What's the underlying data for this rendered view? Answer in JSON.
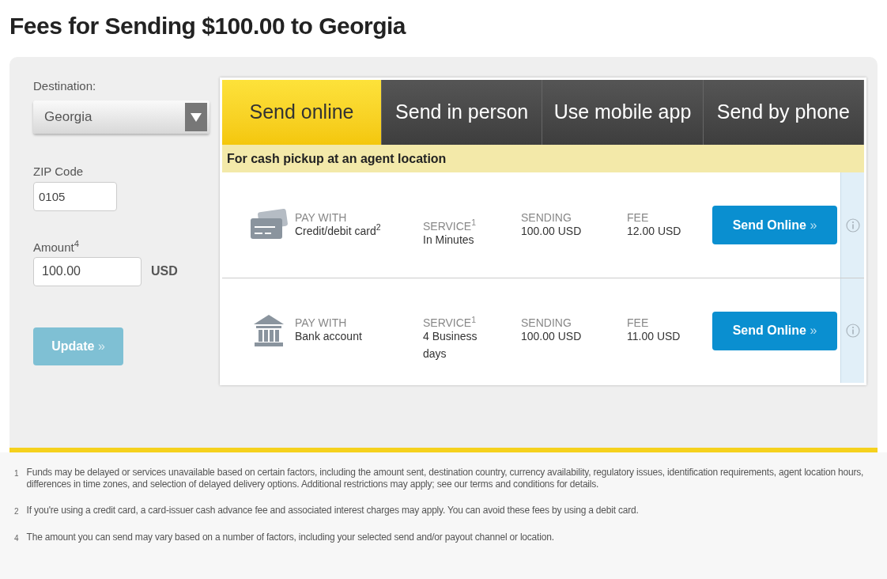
{
  "title": "Fees for Sending $100.00 to Georgia",
  "form": {
    "destination": {
      "label": "Destination:",
      "value": "Georgia"
    },
    "zip": {
      "label": "ZIP Code",
      "value": "0105"
    },
    "amount": {
      "label": "Amount$^{4}$",
      "value": "100.00",
      "currency": "USD"
    },
    "update": {
      "label": "Update",
      "chevron": "»",
      "disabled": true
    }
  },
  "tabs": [
    {
      "label": "Send online",
      "selected": true
    },
    {
      "label": "Send in person",
      "selected": false
    },
    {
      "label": "Use mobile app",
      "selected": false
    },
    {
      "label": "Send by phone",
      "selected": false
    }
  ],
  "banner": "For cash pickup at an agent location",
  "options": [
    {
      "kind": "card",
      "pay_label": "PAY WITH",
      "pay_value": "Credit/debit card$^{2}$",
      "service_label": "SERVICE$^{1}$",
      "service_value": "In Minutes",
      "sending_label": "SENDING",
      "sending_value": "100.00 USD",
      "fee_label": "FEE",
      "fee_value": "12.00 USD",
      "button": "Send Online",
      "chevron": "»"
    },
    {
      "kind": "bank",
      "pay_label": "PAY WITH",
      "pay_value": "Bank account",
      "service_label": "SERVICE$^{1}$",
      "service_value": "4 Business days",
      "sending_label": "SENDING",
      "sending_value": "100.00 USD",
      "fee_label": "FEE",
      "fee_value": "11.00 USD",
      "button": "Send Online",
      "chevron": "»"
    }
  ],
  "footnotes": [
    {
      "mark": "1",
      "text": "Funds may be delayed or services unavailable based on certain factors, including the amount sent, destination country, currency availability, regulatory issues, identification requirements, agent location hours, differences in time zones, and selection of delayed delivery options. Additional restrictions may apply; see our terms and conditions for details."
    },
    {
      "mark": "2",
      "text": "If you're using a credit card, a card-issuer cash advance fee and associated interest charges may apply. You can avoid these fees by using a debit card."
    },
    {
      "mark": "4",
      "text": "The amount you can send may vary based on a number of factors, including your selected send and/or payout channel or location."
    }
  ]
}
